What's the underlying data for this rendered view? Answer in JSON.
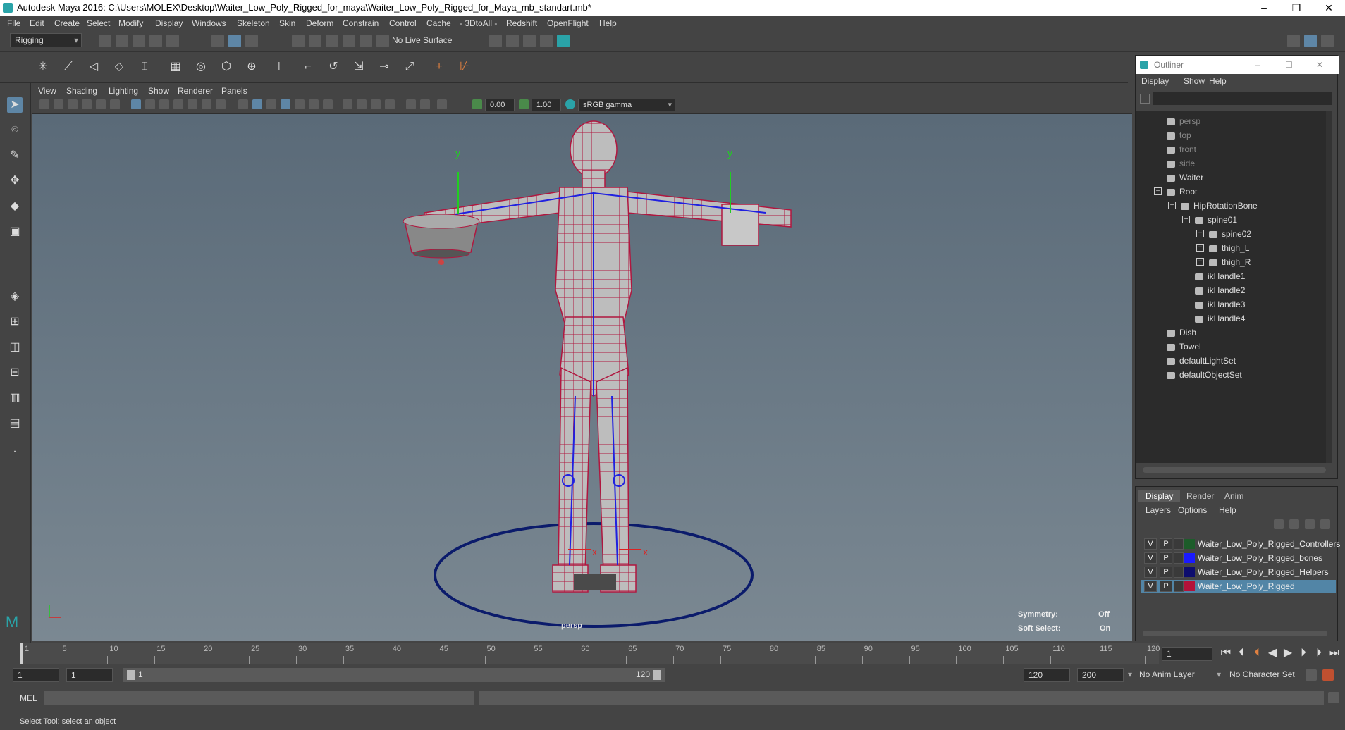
{
  "window": {
    "title": "Autodesk Maya 2016: C:\\Users\\MOLEX\\Desktop\\Waiter_Low_Poly_Rigged_for_maya\\Waiter_Low_Poly_Rigged_for_Maya_mb_standart.mb*"
  },
  "menus": [
    "File",
    "Edit",
    "Create",
    "Select",
    "Modify",
    "Display",
    "Windows",
    "Skeleton",
    "Skin",
    "Deform",
    "Constrain",
    "Control",
    "Cache",
    "- 3DtoAll -",
    "Redshift",
    "OpenFlight",
    "Help"
  ],
  "shelf": {
    "mode": "Rigging",
    "live_surface": "No Live Surface"
  },
  "viewport": {
    "menus": [
      "View",
      "Shading",
      "Lighting",
      "Show",
      "Renderer",
      "Panels"
    ],
    "exposure": "0.00",
    "gamma": "1.00",
    "colorspace": "sRGB gamma",
    "camera_label": "persp",
    "axis_y": "y",
    "axis_x": "x",
    "symmetry_label": "Symmetry:",
    "symmetry_value": "Off",
    "soft_select_label": "Soft Select:",
    "soft_select_value": "On"
  },
  "outliner": {
    "title": "Outliner",
    "menus": [
      "Display",
      "Show",
      "Help"
    ],
    "nodes": [
      {
        "label": "persp",
        "indent": 0,
        "dim": true
      },
      {
        "label": "top",
        "indent": 0,
        "dim": true
      },
      {
        "label": "front",
        "indent": 0,
        "dim": true
      },
      {
        "label": "side",
        "indent": 0,
        "dim": true
      },
      {
        "label": "Waiter",
        "indent": 0
      },
      {
        "label": "Root",
        "indent": 0,
        "expander": "−"
      },
      {
        "label": "HipRotationBone",
        "indent": 1,
        "expander": "−"
      },
      {
        "label": "spine01",
        "indent": 2,
        "expander": "−"
      },
      {
        "label": "spine02",
        "indent": 3,
        "expander": "+"
      },
      {
        "label": "thigh_L",
        "indent": 3,
        "expander": "+"
      },
      {
        "label": "thigh_R",
        "indent": 3,
        "expander": "+"
      },
      {
        "label": "ikHandle1",
        "indent": 2
      },
      {
        "label": "ikHandle2",
        "indent": 2
      },
      {
        "label": "ikHandle3",
        "indent": 2
      },
      {
        "label": "ikHandle4",
        "indent": 2
      },
      {
        "label": "Dish",
        "indent": 0
      },
      {
        "label": "Towel",
        "indent": 0
      },
      {
        "label": "defaultLightSet",
        "indent": 0
      },
      {
        "label": "defaultObjectSet",
        "indent": 0
      }
    ]
  },
  "layer_editor": {
    "tabs": [
      "Display",
      "Render",
      "Anim"
    ],
    "menus": [
      "Layers",
      "Options",
      "Help"
    ],
    "layers": [
      {
        "v": "V",
        "p": "P",
        "color": "#1d5c2a",
        "name": "Waiter_Low_Poly_Rigged_Controllers"
      },
      {
        "v": "V",
        "p": "P",
        "color": "#1a1aff",
        "name": "Waiter_Low_Poly_Rigged_bones"
      },
      {
        "v": "V",
        "p": "P",
        "color": "#0d0d6e",
        "name": "Waiter_Low_Poly_Rigged_Helpers"
      },
      {
        "v": "V",
        "p": "P",
        "color": "#b3123a",
        "name": "Waiter_Low_Poly_Rigged",
        "selected": true
      }
    ]
  },
  "timeline": {
    "ticks": [
      "1",
      "5",
      "10",
      "15",
      "20",
      "25",
      "30",
      "35",
      "40",
      "45",
      "50",
      "55",
      "60",
      "65",
      "70",
      "75",
      "80",
      "85",
      "90",
      "95",
      "100",
      "105",
      "110",
      "115",
      "120"
    ],
    "current_frame": "1"
  },
  "range": {
    "start": "1",
    "playback_start": "1",
    "slider_start": "1",
    "slider_end": "120",
    "playback_end": "120",
    "end": "200",
    "anim_layer": "No Anim Layer",
    "character_set": "No Character Set"
  },
  "command": {
    "label": "MEL"
  },
  "status": {
    "text": "Select Tool: select an object"
  }
}
